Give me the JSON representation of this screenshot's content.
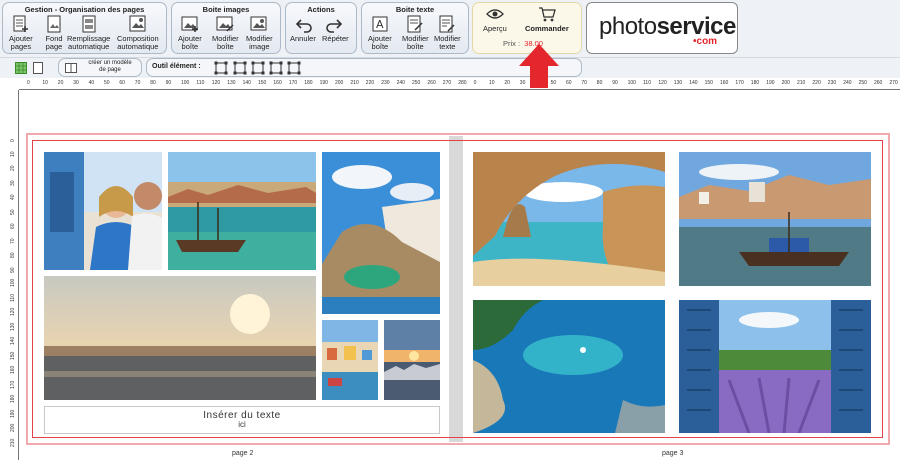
{
  "toolbar": {
    "groups": {
      "gestion": {
        "title": "Gestion - Organisation des pages",
        "tools": [
          "Ajouter\npages",
          "Fond\npage",
          "Remplissage\nautomatique",
          "Composition\nautomatique"
        ]
      },
      "boite_images": {
        "title": "Boite images",
        "tools": [
          "Ajouter\nboîte",
          "Modifier\nboîte",
          "Modifier\nimage"
        ]
      },
      "actions": {
        "title": "Actions",
        "tools": [
          "Annuler",
          "Répéter"
        ]
      },
      "boite_texte": {
        "title": "Boite texte",
        "tools": [
          "Ajouter\nboîte",
          "Modifier\nboîte",
          "Modifier\ntexte"
        ]
      }
    },
    "order": {
      "preview_label": "Aperçu",
      "order_label": "Commander",
      "price_label": "Prix :",
      "price_value": "38.00"
    },
    "logo": {
      "text_light": "photo",
      "text_bold": "service",
      "text_sub": "•com"
    }
  },
  "toolbar2": {
    "create_model_label": "créer un modèle\nde page",
    "tool_element_label": "Outil élément :"
  },
  "rulers": {
    "top_ticks": [
      "0",
      "10",
      "20",
      "30",
      "40",
      "50",
      "60",
      "70",
      "80",
      "90",
      "100",
      "110",
      "120",
      "130",
      "140",
      "150",
      "160",
      "170",
      "180",
      "190",
      "200",
      "210",
      "220",
      "230",
      "240",
      "250",
      "260",
      "270",
      "280",
      "0",
      "10",
      "20",
      "30",
      "40",
      "50",
      "60",
      "70",
      "80",
      "90",
      "100",
      "110",
      "120",
      "130",
      "140",
      "150",
      "160",
      "170",
      "180",
      "190",
      "200",
      "210",
      "220",
      "230",
      "240",
      "250",
      "260",
      "270",
      "280"
    ],
    "left_ticks": [
      "0",
      "10",
      "20",
      "30",
      "40",
      "50",
      "60",
      "70",
      "80",
      "90",
      "100",
      "110",
      "120",
      "130",
      "140",
      "150",
      "160",
      "170",
      "180",
      "190",
      "200",
      "210"
    ]
  },
  "pages": {
    "left_label": "page 2",
    "right_label": "page 3",
    "text_placeholder_line1": "Insérer du texte",
    "text_placeholder_line2": "ici"
  },
  "colors": {
    "accent_red": "#e4262d",
    "toolbar_bg": "#eef1f5",
    "guide_red": "#e3424b"
  }
}
